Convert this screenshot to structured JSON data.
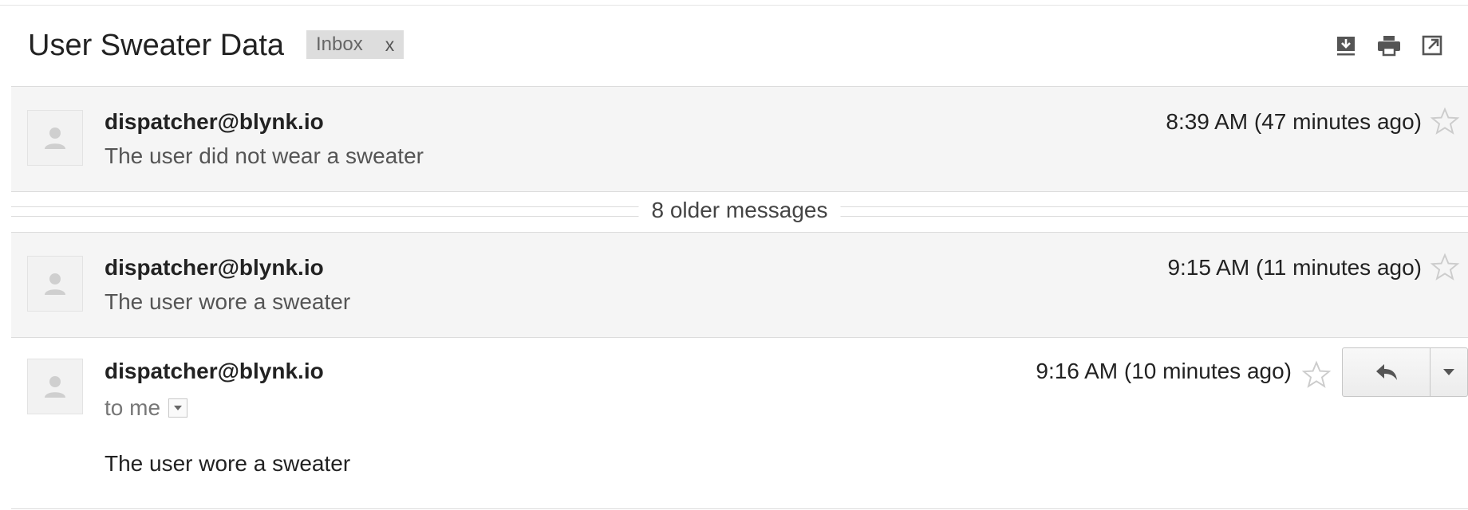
{
  "header": {
    "subject": "User Sweater Data",
    "label": "Inbox",
    "label_remove": "x",
    "actions": [
      "download-icon",
      "print-icon",
      "new-window-icon"
    ]
  },
  "thread": {
    "messages": [
      {
        "sender": "dispatcher@blynk.io",
        "time": "8:39 AM (47 minutes ago)",
        "snippet": "The user did not wear a sweater",
        "starred": false
      },
      {
        "sender": "dispatcher@blynk.io",
        "time": "9:15 AM (11 minutes ago)",
        "snippet": "The user wore a sweater",
        "starred": false
      }
    ],
    "older_messages": "8 older messages",
    "open_message": {
      "sender": "dispatcher@blynk.io",
      "time": "9:16 AM (10 minutes ago)",
      "recipient": "to me",
      "body": "The user wore a sweater",
      "starred": false
    }
  },
  "colors": {
    "collapsed_bg": "#f5f5f5",
    "chip_bg": "#dddddd",
    "star_outline": "#cccccc"
  }
}
